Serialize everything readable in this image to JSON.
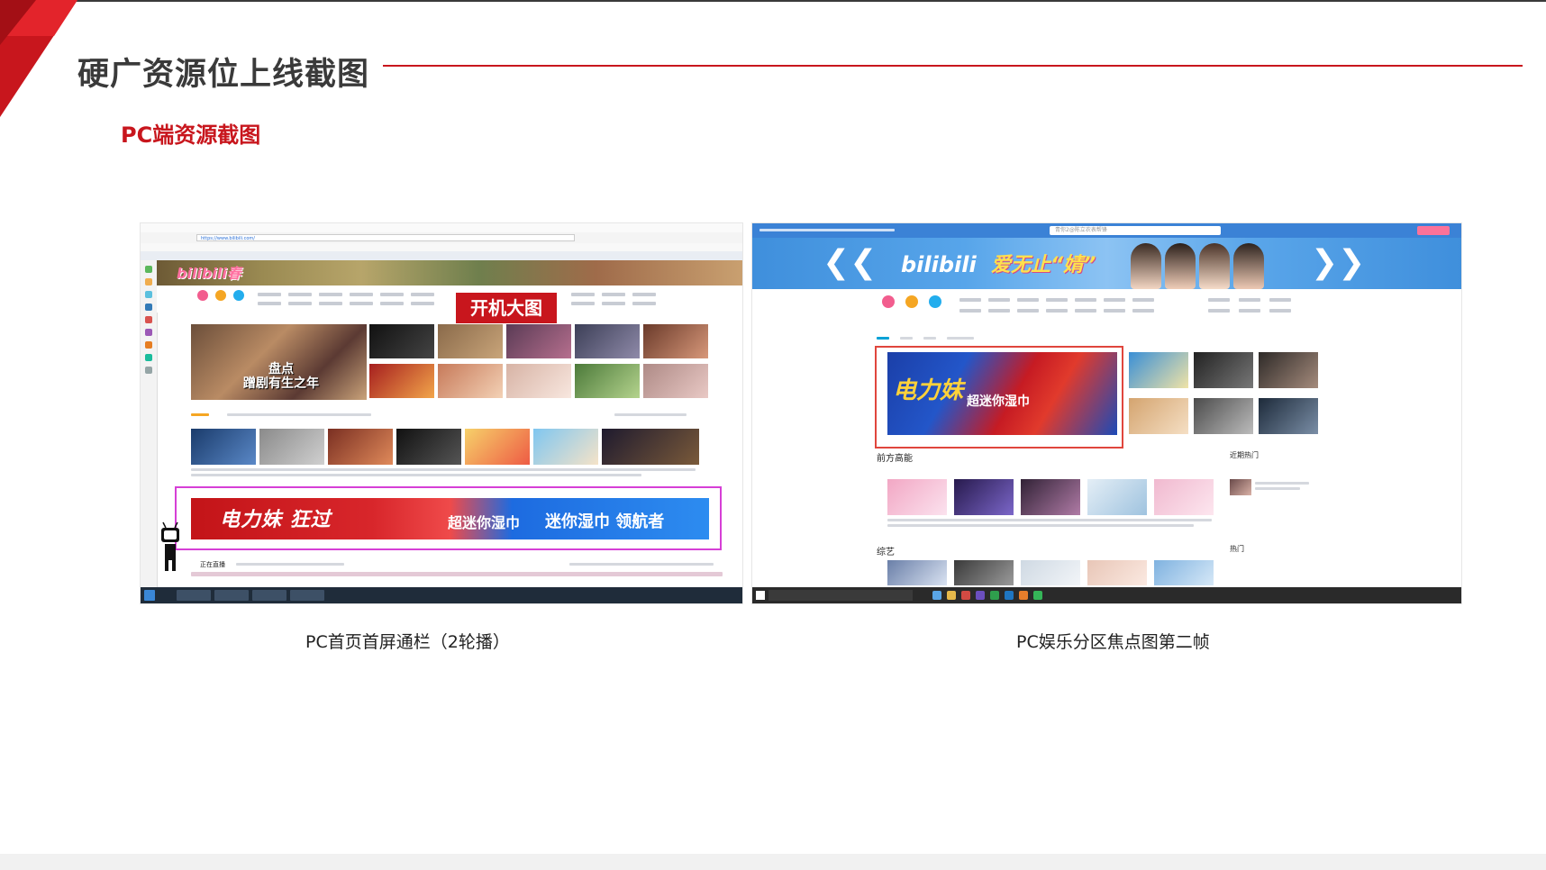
{
  "slide": {
    "title": "硬广资源位上线截图",
    "subtitle": "PC端资源截图",
    "accent_color": "#c8161d"
  },
  "screens": [
    {
      "caption": "PC首页首屏通栏（2轮播）",
      "url": "https://www.bilibili.com/",
      "logo_text": "bilibili春",
      "carousel_text": "盘点\n蹭剧有生之年",
      "feature_label": "开机大图",
      "ad_text_1": "电力妹 狂过",
      "ad_text_2": "超迷你湿巾",
      "ad_text_3": "迷你湿巾 领航者",
      "live_label": "正在直播"
    },
    {
      "caption": "PC娱乐分区焦点图第二帧",
      "search_placeholder": "青你2@陈立农表帮锋",
      "banner_logo": "bilibili",
      "banner_slogan": "爱无止“婧”",
      "focus_text_1": "电力妹",
      "focus_text_2": "超迷你湿巾",
      "section_left": "前方高能",
      "section_right": "近期热门",
      "section_bottom": "综艺",
      "section_bottom_right": "热门"
    }
  ]
}
